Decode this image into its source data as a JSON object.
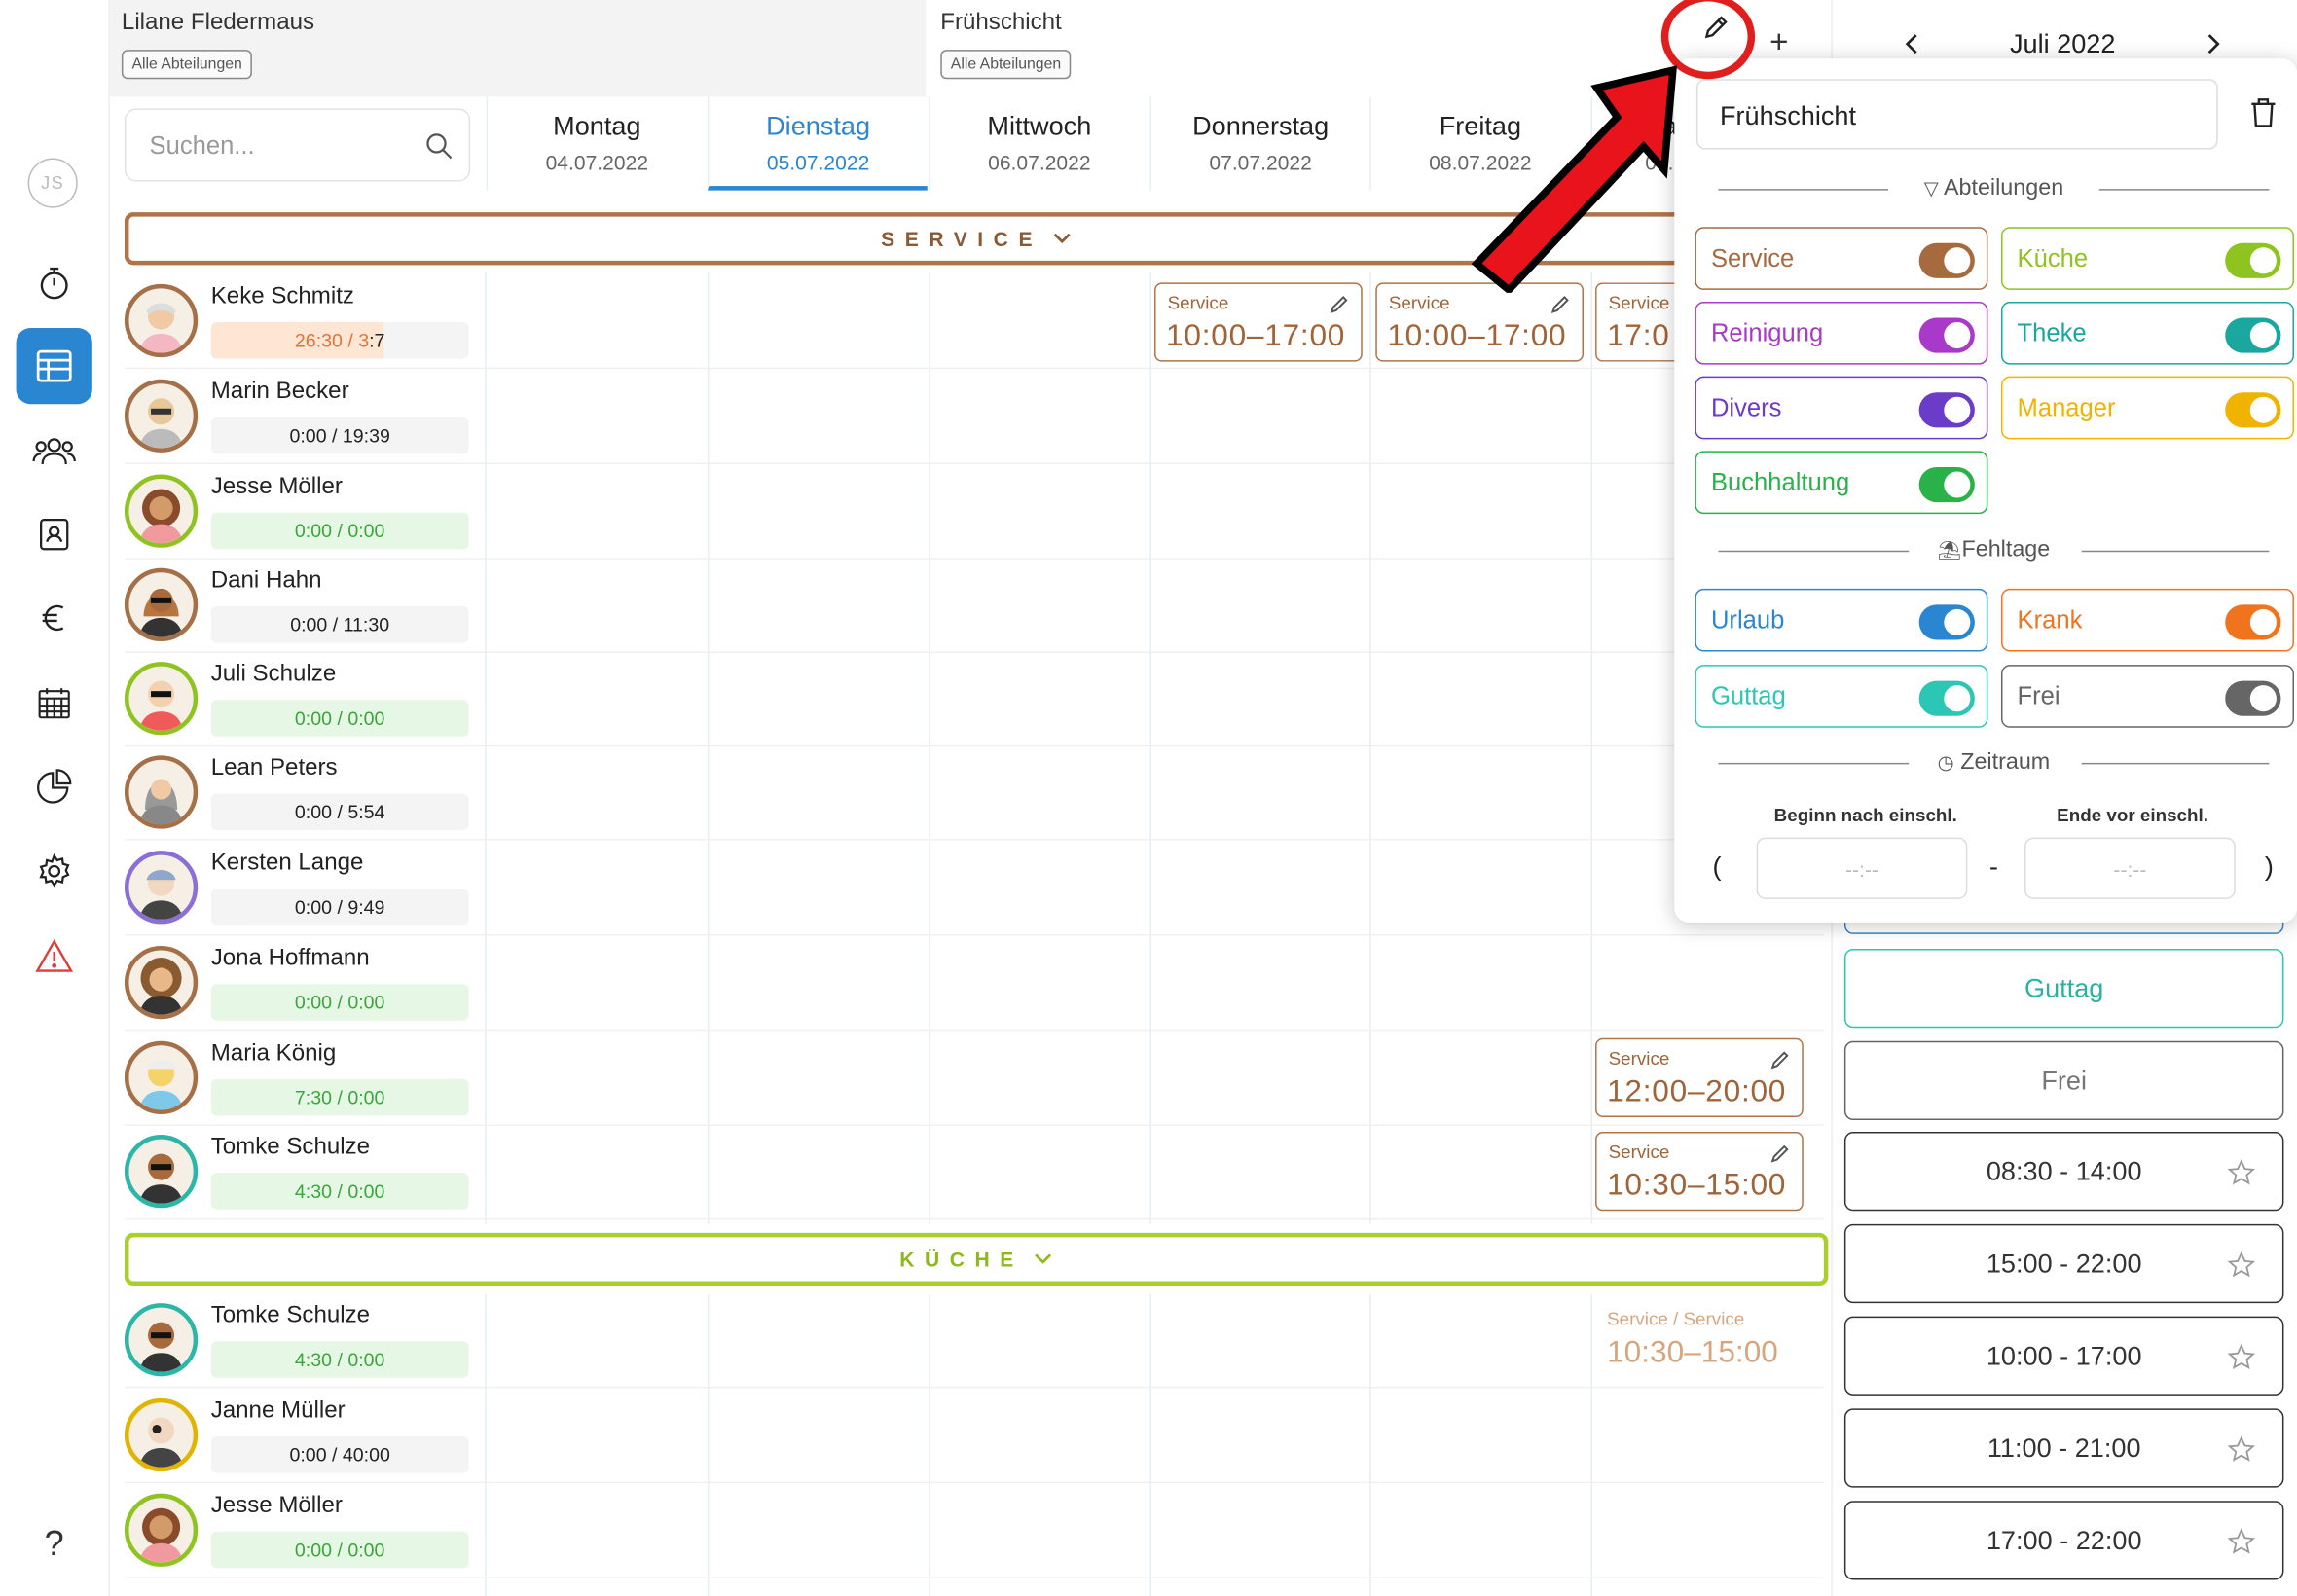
{
  "sidebar": {
    "user_initials": "JS",
    "help_label": "?"
  },
  "top": {
    "left_cell": {
      "name": "Lilane Fledermaus",
      "chip": "Alle Abteilungen"
    },
    "right_cell": {
      "name": "Frühschicht",
      "chip": "Alle Abteilungen"
    },
    "add_label": "+"
  },
  "search": {
    "placeholder": "Suchen..."
  },
  "days": [
    {
      "name": "Montag",
      "date": "04.07.2022"
    },
    {
      "name": "Dienstag",
      "date": "05.07.2022"
    },
    {
      "name": "Mittwoch",
      "date": "06.07.2022"
    },
    {
      "name": "Donnerstag",
      "date": "07.07.2022"
    },
    {
      "name": "Freitag",
      "date": "08.07.2022"
    },
    {
      "name": "Sa",
      "date": "09."
    }
  ],
  "groups": {
    "service": "SERVICE",
    "kueche": "KÜCHE"
  },
  "employees": [
    {
      "name": "Keke Schmitz",
      "hours_a": "26:30 / 3",
      "hours_b": ":7"
    },
    {
      "name": "Marin Becker",
      "hours": "0:00 / 19:39"
    },
    {
      "name": "Jesse Möller",
      "hours": "0:00 / 0:00"
    },
    {
      "name": "Dani Hahn",
      "hours": "0:00 / 11:30"
    },
    {
      "name": "Juli Schulze",
      "hours": "0:00 / 0:00"
    },
    {
      "name": "Lean Peters",
      "hours": "0:00 / 5:54"
    },
    {
      "name": "Kersten Lange",
      "hours": "0:00 / 9:49"
    },
    {
      "name": "Jona Hoffmann",
      "hours": "0:00 / 0:00"
    },
    {
      "name": "Maria König",
      "hours": "7:30 / 0:00"
    },
    {
      "name": "Tomke Schulze",
      "hours": "4:30 / 0:00"
    }
  ],
  "kueche_employees": [
    {
      "name": "Tomke Schulze",
      "hours": "4:30 / 0:00"
    },
    {
      "name": "Janne Müller",
      "hours": "0:00 / 40:00"
    },
    {
      "name": "Jesse Möller",
      "hours": "0:00 / 0:00"
    }
  ],
  "shifts": [
    {
      "label": "Service",
      "time": "10:00–17:00"
    },
    {
      "label": "Service",
      "time": "10:00–17:00"
    },
    {
      "label": "Service",
      "time": "17:0"
    },
    {
      "label": "Service",
      "time": "12:00–20:00"
    },
    {
      "label": "Service",
      "time": "10:30–15:00"
    }
  ],
  "ghost_shift": {
    "label": "Service / Service",
    "time": "10:30–15:00"
  },
  "calendar": {
    "month": "Juli 2022"
  },
  "right_buttons": [
    {
      "label": "Guttag"
    },
    {
      "label": "Frei"
    },
    {
      "label": "08:30 - 14:00"
    },
    {
      "label": "15:00 - 22:00"
    },
    {
      "label": "10:00 - 17:00"
    },
    {
      "label": "11:00 - 21:00"
    },
    {
      "label": "17:00 - 22:00"
    }
  ],
  "popup": {
    "name_value": "Frühschicht",
    "sect_abteilungen": "Abteilungen",
    "sect_fehltage": "Fehltage",
    "sect_zeitraum": "Zeitraum",
    "abteilungen": [
      {
        "label": "Service",
        "color": "#a66a3f"
      },
      {
        "label": "Küche",
        "color": "#8fc31f"
      },
      {
        "label": "Reinigung",
        "color": "#a93ac9"
      },
      {
        "label": "Theke",
        "color": "#1aa7a0"
      },
      {
        "label": "Divers",
        "color": "#6a3cc8"
      },
      {
        "label": "Manager",
        "color": "#f0b400"
      },
      {
        "label": "Buchhaltung",
        "color": "#2ab24a"
      }
    ],
    "fehltage": [
      {
        "label": "Urlaub",
        "color": "#2a86d1"
      },
      {
        "label": "Krank",
        "color": "#f0741e"
      },
      {
        "label": "Guttag",
        "color": "#2bc7b4"
      },
      {
        "label": "Frei",
        "color": "#666666"
      }
    ],
    "begin_label": "Beginn nach einschl.",
    "end_label": "Ende vor einschl.",
    "time_placeholder": "--:--",
    "dash": "-",
    "open_bracket": "(",
    "close_bracket": ")"
  }
}
